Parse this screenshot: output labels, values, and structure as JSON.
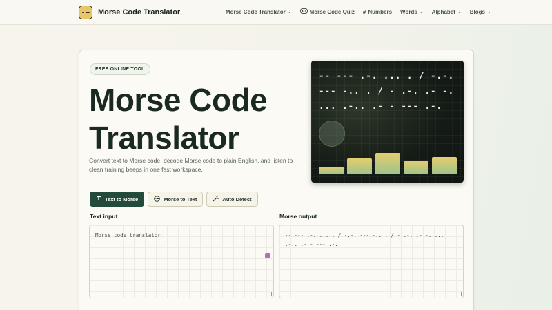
{
  "brand": {
    "name": "Morse Code Translator",
    "logo_icon": "morse-logo-icon"
  },
  "nav": [
    {
      "label": "Morse Code Translator",
      "icon": "",
      "has_dropdown": true
    },
    {
      "label": "Morse Code Quiz",
      "icon": "gamepad-icon",
      "has_dropdown": false
    },
    {
      "label": "Numbers",
      "icon": "hash-icon",
      "has_dropdown": false
    },
    {
      "label": "Words",
      "icon": "",
      "has_dropdown": true
    },
    {
      "label": "Alphabet",
      "icon": "",
      "has_dropdown": true
    },
    {
      "label": "Blogs",
      "icon": "",
      "has_dropdown": true
    }
  ],
  "hero": {
    "badge": "FREE ONLINE TOOL",
    "title_line1": "Morse Code",
    "title_line2": "Translator",
    "description": "Convert text to Morse code, decode Morse code to plain English, and listen to clean training beeps in one fast workspace."
  },
  "modes": [
    {
      "label": "Text to Morse",
      "icon": "text-icon",
      "active": true
    },
    {
      "label": "Morse to Text",
      "icon": "morse-icon",
      "active": false
    },
    {
      "label": "Auto Detect",
      "icon": "wand-icon",
      "active": false
    }
  ],
  "text_input": {
    "label": "Text input",
    "value": "Morse code translator"
  },
  "morse_output": {
    "label": "Morse output",
    "line1": "-- --- .-. ... . / -.-. --- -.. . / - .-. .- -. ...",
    "line2": ".-.. .- - --- .-."
  },
  "visual": {
    "lines": [
      "-- --- .-. ... . / -.-.",
      "--- -.. . / - .-. .- -.",
      "... .-.. .- - --- .-."
    ],
    "bar_levels": [
      0.22,
      0.45,
      0.62,
      0.38,
      0.5
    ]
  },
  "colors": {
    "accent": "#234b3b",
    "badge_text": "#1e3a2c",
    "logo": "#e8c768"
  }
}
